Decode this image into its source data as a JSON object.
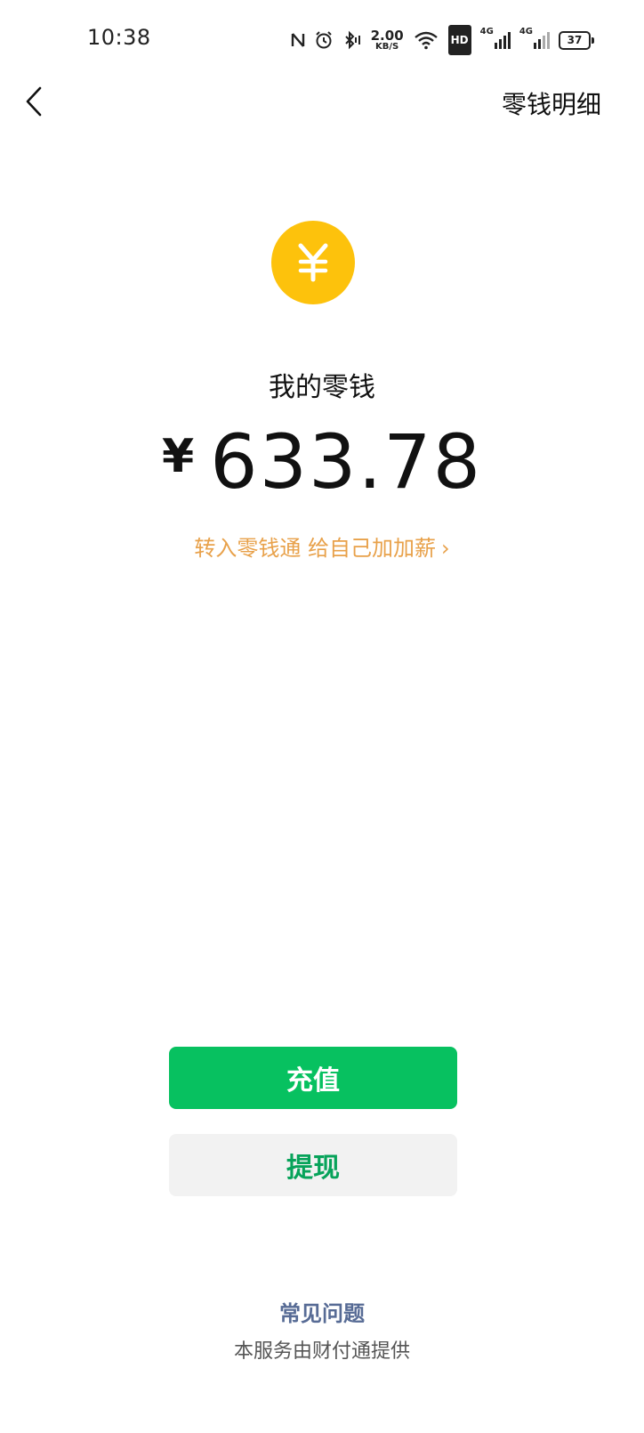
{
  "status_bar": {
    "time": "10:38",
    "net_speed_value": "2.00",
    "net_speed_unit": "KB/S",
    "hd_badge": "HD",
    "signal_label_1": "4G",
    "signal_label_2": "4G",
    "battery_level": "37",
    "icons": [
      "nfc-icon",
      "alarm-icon",
      "bluetooth-icon",
      "wifi-icon",
      "signal-icon",
      "signal-icon",
      "battery-icon"
    ]
  },
  "nav": {
    "back_icon": "chevron-left-icon",
    "title": "零钱明细"
  },
  "balance": {
    "coin_symbol": "¥",
    "label": "我的零钱",
    "currency": "¥",
    "amount": "633.78",
    "promo_text": "转入零钱通 给自己加加薪",
    "promo_chevron": "›"
  },
  "actions": {
    "recharge_label": "充值",
    "withdraw_label": "提现"
  },
  "footer": {
    "faq_label": "常见问题",
    "note": "本服务由财付通提供"
  },
  "colors": {
    "coin": "#FDC20C",
    "primary_green": "#07C160",
    "withdraw_text": "#07A35A",
    "withdraw_bg": "#F2F2F2",
    "promo": "#E8A14A",
    "link_blue": "#576B95"
  }
}
